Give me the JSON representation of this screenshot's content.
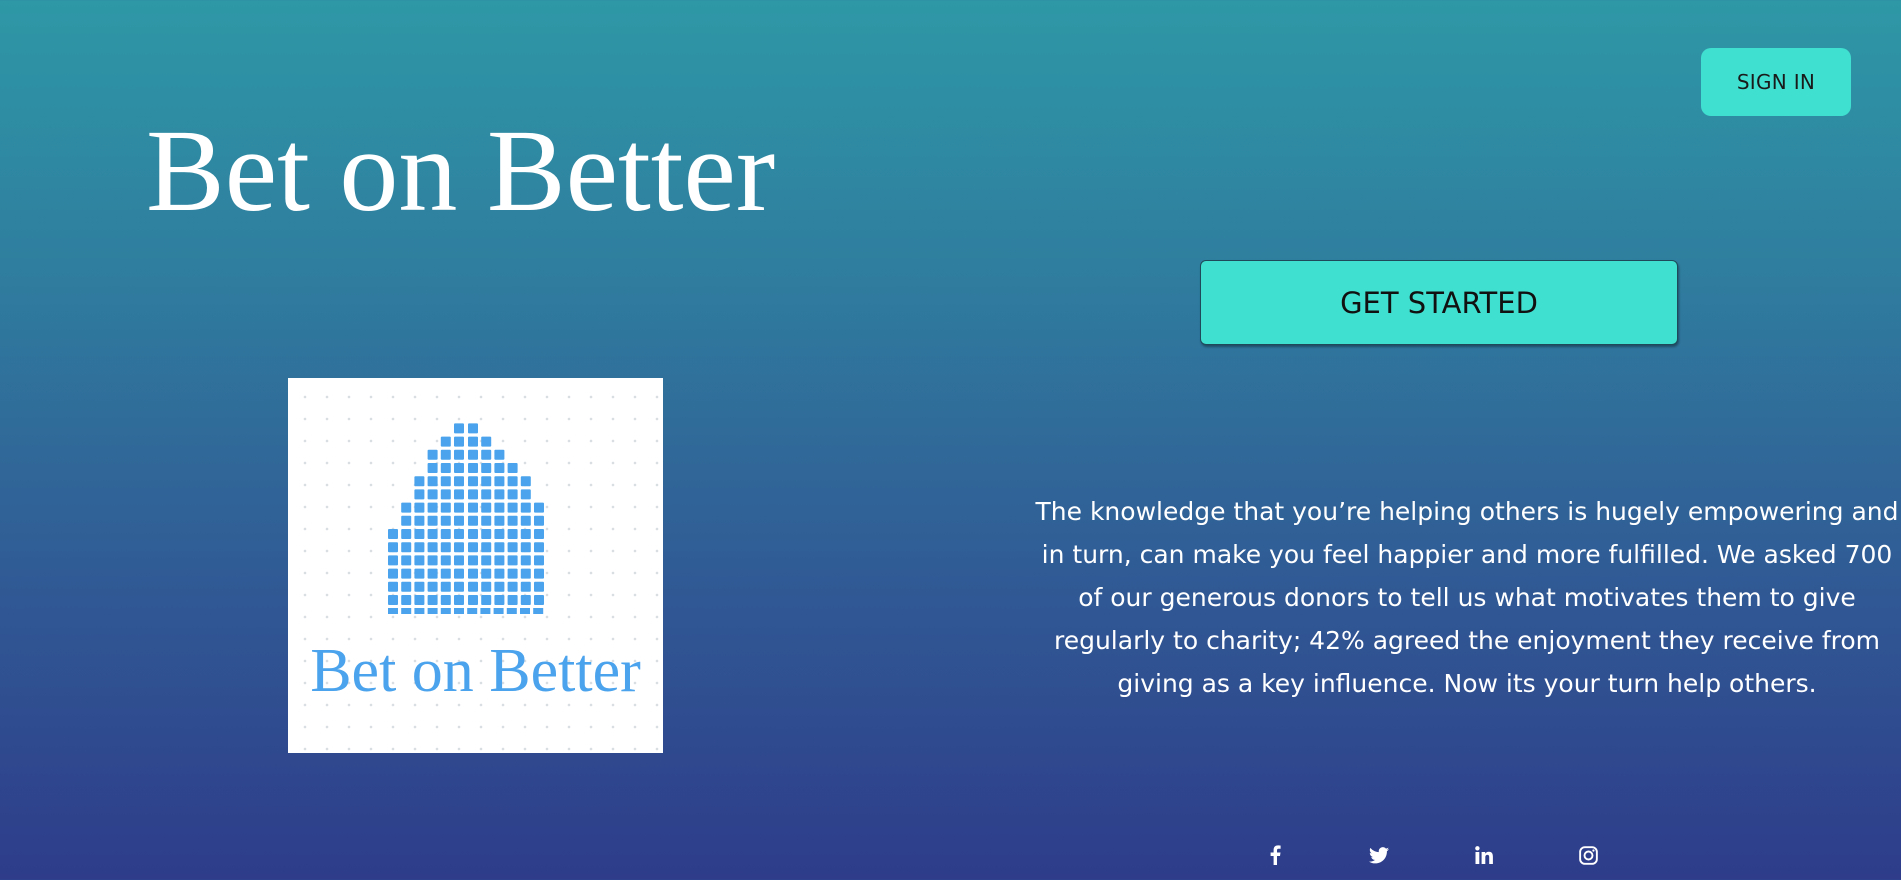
{
  "header": {
    "sign_in_label": "SIGN IN"
  },
  "hero": {
    "title": "Bet on Better",
    "cta_label": "GET STARTED"
  },
  "logo": {
    "text": "Bet on Better",
    "icon": "building-icon",
    "color": "#4aa3ec"
  },
  "description": {
    "text": "The knowledge that you’re helping others is hugely empowering and in turn, can make you feel happier and more fulfilled. We asked 700 of our generous donors to tell us what motivates them to give regularly to charity; 42% agreed the enjoyment they receive from giving as a key influence. Now its your turn help others."
  },
  "social": [
    {
      "name": "facebook-icon"
    },
    {
      "name": "twitter-icon"
    },
    {
      "name": "linkedin-icon"
    },
    {
      "name": "instagram-icon"
    }
  ],
  "colors": {
    "accent": "#40e0d0",
    "background_top": "#2e98a6",
    "background_bottom": "#2e3c8a"
  }
}
